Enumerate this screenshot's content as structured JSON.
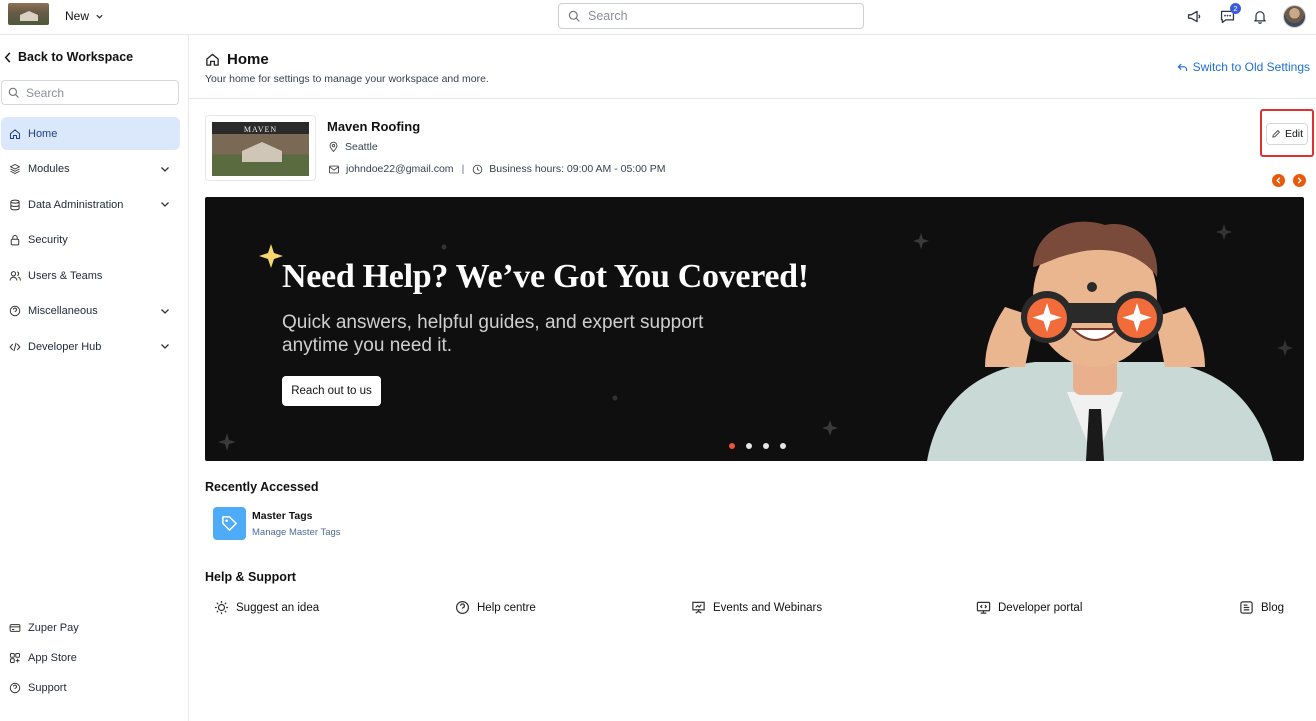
{
  "topbar": {
    "new_label": "New",
    "search_placeholder": "Search",
    "messages_badge": "2"
  },
  "sidebar": {
    "back_label": "Back to Workspace",
    "search_placeholder": "Search",
    "items": [
      {
        "label": "Home",
        "icon": "home-icon",
        "active": true,
        "expandable": false
      },
      {
        "label": "Modules",
        "icon": "layers-icon",
        "active": false,
        "expandable": true
      },
      {
        "label": "Data Administration",
        "icon": "database-icon",
        "active": false,
        "expandable": true
      },
      {
        "label": "Security",
        "icon": "lock-icon",
        "active": false,
        "expandable": false
      },
      {
        "label": "Users & Teams",
        "icon": "users-icon",
        "active": false,
        "expandable": false
      },
      {
        "label": "Miscellaneous",
        "icon": "help-circle-icon",
        "active": false,
        "expandable": true
      },
      {
        "label": "Developer Hub",
        "icon": "code-icon",
        "active": false,
        "expandable": true
      }
    ],
    "bottom": [
      {
        "label": "Zuper Pay",
        "icon": "pay-icon"
      },
      {
        "label": "App Store",
        "icon": "app-store-icon"
      },
      {
        "label": "Support",
        "icon": "support-icon"
      }
    ]
  },
  "header": {
    "title": "Home",
    "subtitle": "Your home for settings to manage your workspace and more.",
    "switch_label": "Switch to Old Settings"
  },
  "business": {
    "logo_text": "MAVEN",
    "name": "Maven Roofing",
    "location": "Seattle",
    "email": "johndoe22@gmail.com",
    "hours": "Business hours: 09:00 AM - 05:00 PM",
    "edit_label": "Edit"
  },
  "banner": {
    "title": "Need Help? We’ve Got You Covered!",
    "subtitle": "Quick answers, helpful guides, and expert support anytime you need it.",
    "button_label": "Reach out to us",
    "slides_count": 4,
    "active_slide": 1
  },
  "recent": {
    "heading": "Recently Accessed",
    "items": [
      {
        "title": "Master Tags",
        "subtitle": "Manage Master Tags",
        "icon": "tag-icon"
      }
    ]
  },
  "help": {
    "heading": "Help & Support",
    "items": [
      {
        "label": "Suggest an idea",
        "icon": "lightbulb-icon"
      },
      {
        "label": "Help centre",
        "icon": "help-circle-icon"
      },
      {
        "label": "Events and Webinars",
        "icon": "presentation-icon"
      },
      {
        "label": "Developer portal",
        "icon": "developer-portal-icon"
      },
      {
        "label": "Blog",
        "icon": "blog-icon"
      }
    ]
  },
  "colors": {
    "accent": "#1d6fd6",
    "active_nav_bg": "#dbe8fb",
    "highlight_red": "#e03131",
    "carousel_orange": "#e8590c",
    "banner_bg": "#0f0f0f"
  }
}
